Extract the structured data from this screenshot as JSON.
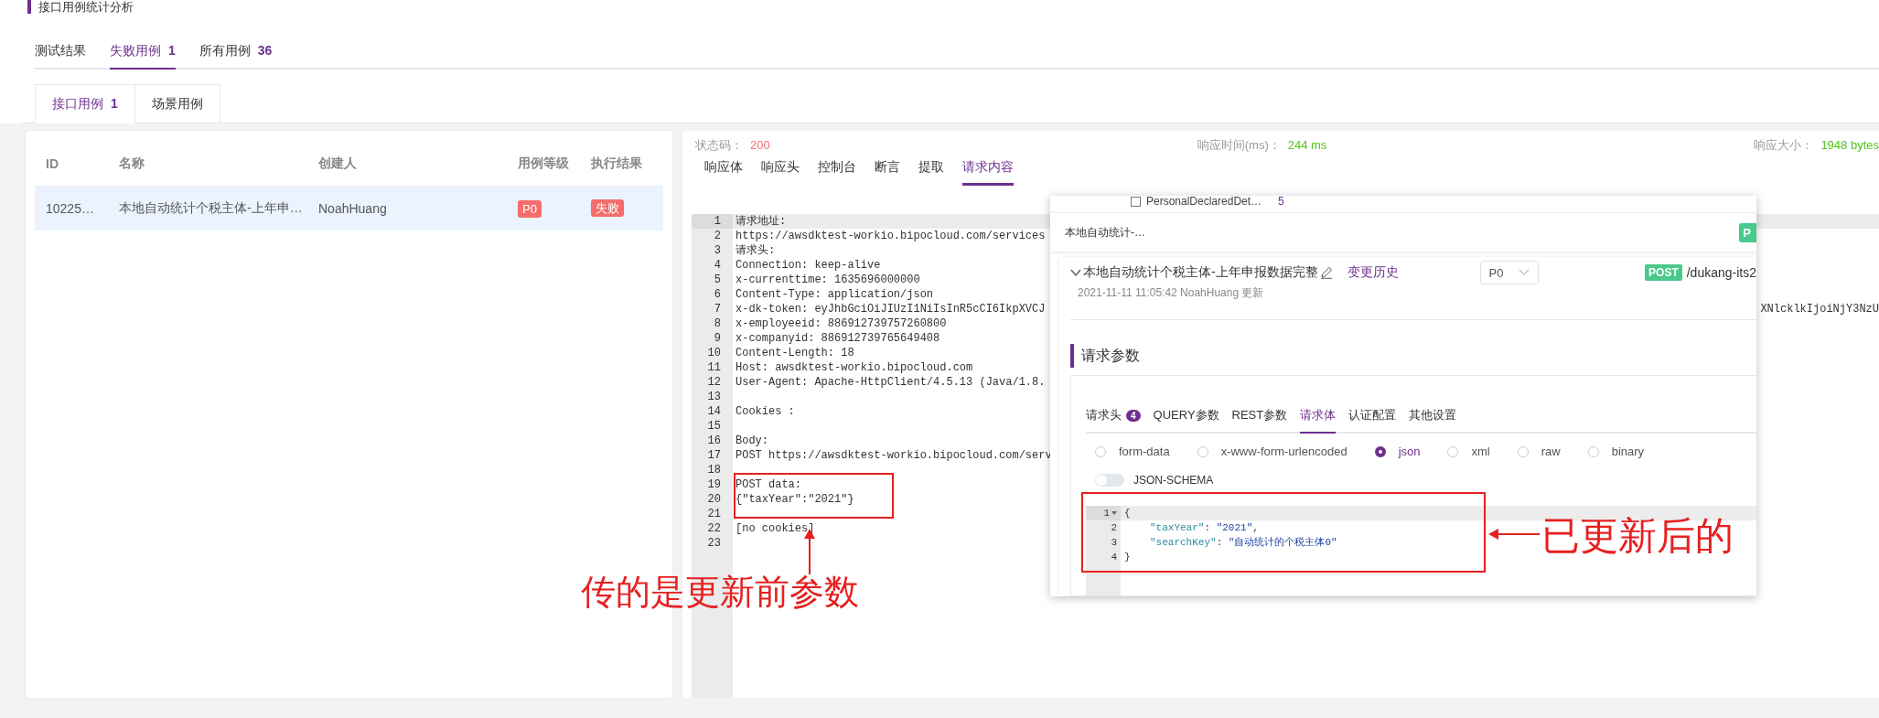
{
  "page_title": "接口用例统计分析",
  "result_tabs": [
    {
      "label": "测试结果",
      "selected": false
    },
    {
      "label": "失败用例",
      "count": "1",
      "selected": true
    },
    {
      "label": "所有用例",
      "count": "36",
      "selected": false
    }
  ],
  "case_tabs": [
    {
      "label": "接口用例",
      "count": "1",
      "selected": true
    },
    {
      "label": "场景用例",
      "selected": false
    }
  ],
  "case_table": {
    "columns": [
      "ID",
      "名称",
      "创建人",
      "用例等级",
      "执行结果"
    ],
    "rows": [
      {
        "id": "10225…",
        "name": "本地自动统计个税主体-上年申…",
        "creator": "NoahHuang",
        "level": "P0",
        "result": "失败",
        "selected": true
      }
    ]
  },
  "response": {
    "status_label": "状态码：",
    "status": "200",
    "time_label": "响应时间(ms)：",
    "time": "244 ms",
    "size_label": "响应大小：",
    "size": "1948 bytes",
    "tabs": [
      {
        "label": "响应体",
        "selected": false
      },
      {
        "label": "响应头",
        "selected": false
      },
      {
        "label": "控制台",
        "selected": false
      },
      {
        "label": "断言",
        "selected": false
      },
      {
        "label": "提取",
        "selected": false
      },
      {
        "label": "请求内容",
        "selected": true
      }
    ],
    "lines": [
      {
        "no": "1",
        "text": "请求地址:",
        "active": true
      },
      {
        "no": "2",
        "text": "https://awsdktest-workio.bipocloud.com/services",
        "active": false
      },
      {
        "no": "3",
        "text": "请求头:",
        "active": false
      },
      {
        "no": "4",
        "text": "Connection: keep-alive",
        "active": false
      },
      {
        "no": "5",
        "text": "x-currenttime: 1635696000000",
        "active": false
      },
      {
        "no": "6",
        "text": "Content-Type: application/json",
        "active": false
      },
      {
        "no": "7",
        "text": "x-dk-token: eyJhbGciOiJIUzI1NiIsInR5cCI6IkpXVCJ",
        "tail": "XNlcklkIjoiNjY3NzU",
        "active": false
      },
      {
        "no": "8",
        "text": "x-employeeid: 886912739757260800",
        "active": false
      },
      {
        "no": "9",
        "text": "x-companyid: 886912739765649408",
        "active": false
      },
      {
        "no": "10",
        "text": "Content-Length: 18",
        "active": false
      },
      {
        "no": "11",
        "text": "Host: awsdktest-workio.bipocloud.com",
        "active": false
      },
      {
        "no": "12",
        "text": "User-Agent: Apache-HttpClient/4.5.13 (Java/1.8.",
        "active": false
      },
      {
        "no": "13",
        "active": false
      },
      {
        "no": "14",
        "text": "Cookies :",
        "active": false
      },
      {
        "no": "15",
        "active": false
      },
      {
        "no": "16",
        "text": "Body:",
        "active": false
      },
      {
        "no": "17",
        "text": "POST https://awsdktest-workio.bipocloud.com/serv",
        "active": false
      },
      {
        "no": "18",
        "active": false
      },
      {
        "no": "19",
        "text": "POST data:",
        "active": false
      },
      {
        "no": "20",
        "text": "{\"taxYear\":\"2021\"}",
        "active": false
      },
      {
        "no": "21",
        "active": false
      },
      {
        "no": "22",
        "text": "[no cookies]",
        "active": false
      },
      {
        "no": "23",
        "active": false
      }
    ]
  },
  "popup": {
    "list_item": {
      "text": "PersonalDeclaredDet…",
      "count": "5",
      "checked": false
    },
    "case_card": {
      "title": "本地自动统计-…",
      "badge": "P"
    },
    "detail": {
      "title": "本地自动统计个税主体-上年申报数据完整",
      "history_link": "变更历史",
      "updated": "2021-11-11 11:05:42 NoahHuang 更新",
      "level": "P0",
      "method": "POST",
      "path": "/dukang-its2"
    },
    "section_title": "请求参数",
    "tabs": [
      {
        "label": "请求头",
        "count": "4",
        "selected": false
      },
      {
        "label": "QUERY参数",
        "selected": false
      },
      {
        "label": "REST参数",
        "selected": false
      },
      {
        "label": "请求体",
        "selected": true
      },
      {
        "label": "认证配置",
        "selected": false
      },
      {
        "label": "其他设置",
        "selected": false
      }
    ],
    "body_types": [
      {
        "label": "form-data",
        "selected": false
      },
      {
        "label": "x-www-form-urlencoded",
        "selected": false
      },
      {
        "label": "json",
        "selected": true
      },
      {
        "label": "xml",
        "selected": false
      },
      {
        "label": "raw",
        "selected": false
      },
      {
        "label": "binary",
        "selected": false
      }
    ],
    "json_schema": {
      "label": "JSON-SCHEMA",
      "on": false
    },
    "editor_lines": [
      {
        "no": "1",
        "text": "{",
        "fold": true
      },
      {
        "no": "2",
        "key": "\"taxYear\"",
        "sep": ":",
        "value": "\"2021\"",
        "comma": ",",
        "fold": false
      },
      {
        "no": "3",
        "key": "\"searchKey\"",
        "sep": ":",
        "value": "\"自动统计的个税主体0\"",
        "fold": false
      },
      {
        "no": "4",
        "text": "}",
        "fold": false
      }
    ]
  },
  "annotations": {
    "before": "传的是更新前参数",
    "after": "已更新后的"
  }
}
